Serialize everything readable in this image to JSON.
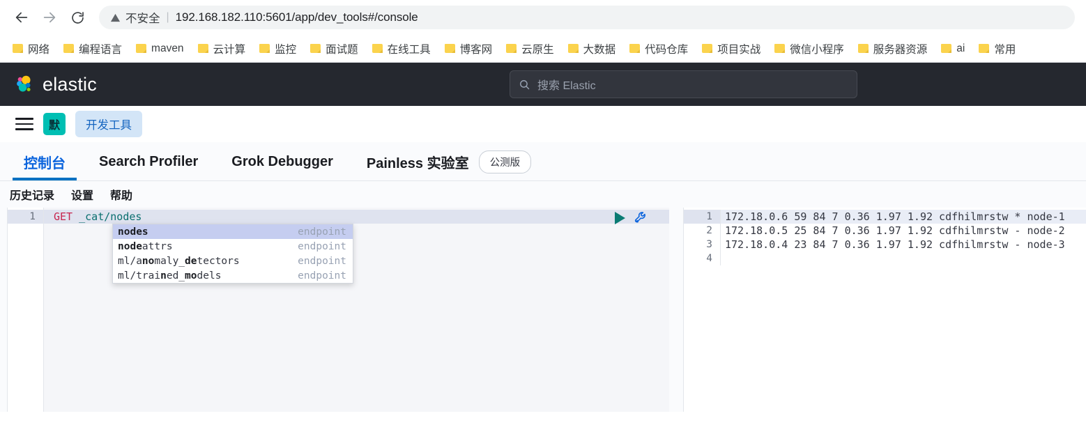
{
  "browser": {
    "back_label": "back-arrow",
    "forward_label": "forward-arrow",
    "reload_label": "reload",
    "not_secure": "不安全",
    "separator": "|",
    "url": "192.168.182.110:5601/app/dev_tools#/console"
  },
  "bookmarks": [
    {
      "label": "网络"
    },
    {
      "label": "编程语言"
    },
    {
      "label": "maven"
    },
    {
      "label": "云计算"
    },
    {
      "label": "监控"
    },
    {
      "label": "面试题"
    },
    {
      "label": "在线工具"
    },
    {
      "label": "博客网"
    },
    {
      "label": "云原生"
    },
    {
      "label": "大数据"
    },
    {
      "label": "代码仓库"
    },
    {
      "label": "项目实战"
    },
    {
      "label": "微信小程序"
    },
    {
      "label": "服务器资源"
    },
    {
      "label": "ai"
    },
    {
      "label": "常用"
    }
  ],
  "header": {
    "brand": "elastic",
    "search_placeholder": "搜索 Elastic",
    "background": "#25282f"
  },
  "breadcrumb": {
    "space_badge": "默",
    "app_name": "开发工具"
  },
  "tabs": [
    {
      "label": "控制台",
      "active": true
    },
    {
      "label": "Search Profiler",
      "active": false
    },
    {
      "label": "Grok Debugger",
      "active": false
    },
    {
      "label": "Painless 实验室",
      "active": false,
      "badge": "公测版"
    }
  ],
  "console_subnav": [
    {
      "label": "历史记录"
    },
    {
      "label": "设置"
    },
    {
      "label": "帮助"
    }
  ],
  "editor": {
    "line_numbers": [
      "1"
    ],
    "request": {
      "method": "GET",
      "path": " _cat/nodes"
    },
    "play_title": "click-to-send-request",
    "wrench_title": "open-documentation"
  },
  "autocomplete": {
    "type_label": "endpoint",
    "items": [
      {
        "parts": [
          {
            "t": "nodes",
            "b": true
          }
        ],
        "type": "endpoint",
        "selected": true
      },
      {
        "parts": [
          {
            "t": "node",
            "b": true
          },
          {
            "t": "attrs",
            "b": false
          }
        ],
        "type": "endpoint",
        "selected": false
      },
      {
        "parts": [
          {
            "t": "ml/a",
            "b": false
          },
          {
            "t": "no",
            "b": true
          },
          {
            "t": "maly_",
            "b": false
          },
          {
            "t": "de",
            "b": true
          },
          {
            "t": "tectors",
            "b": false
          }
        ],
        "type": "endpoint",
        "selected": false
      },
      {
        "parts": [
          {
            "t": "ml/trai",
            "b": false
          },
          {
            "t": "n",
            "b": true
          },
          {
            "t": "ed_",
            "b": false
          },
          {
            "t": "mo",
            "b": true
          },
          {
            "t": "dels",
            "b": false
          }
        ],
        "type": "endpoint",
        "selected": false
      }
    ]
  },
  "output": {
    "line_numbers": [
      "1",
      "2",
      "3",
      "4"
    ],
    "lines": [
      "172.18.0.6 59 84 7 0.36 1.97 1.92 cdfhilmrstw * node-1",
      "172.18.0.5 25 84 7 0.36 1.97 1.92 cdfhilmrstw - node-2",
      "172.18.0.4 23 84 7 0.36 1.97 1.92 cdfhilmrstw - node-3",
      ""
    ]
  },
  "colors": {
    "accent_blue": "#0071c2",
    "space_teal": "#00bfb3",
    "method_crimson": "#c7254e",
    "path_teal": "#0a6f6f",
    "ac_selected": "#c5cdf0"
  }
}
